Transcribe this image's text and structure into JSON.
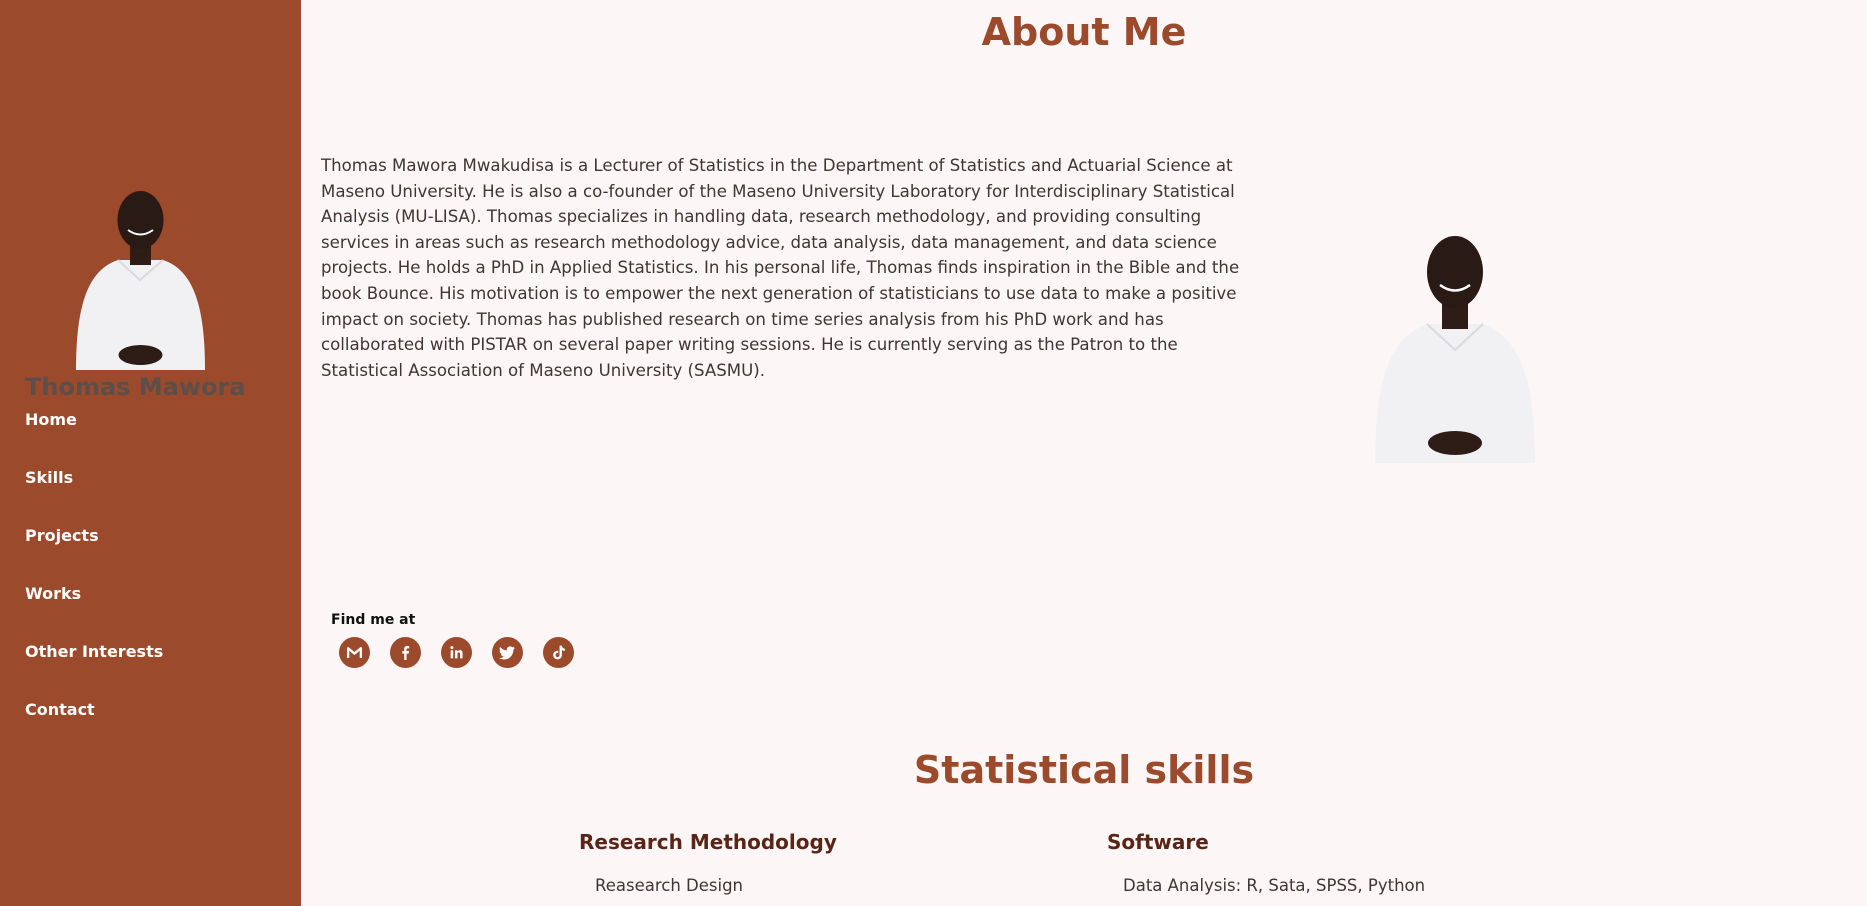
{
  "sidebar": {
    "name": "Thomas Mawora",
    "nav": [
      "Home",
      "Skills",
      "Projects",
      "Works",
      "Other Interests",
      "Contact"
    ]
  },
  "about": {
    "title": "About Me",
    "text": "Thomas Mawora Mwakudisa is a Lecturer of Statistics in the Department of Statistics and Actuarial Science at Maseno University. He is also a co-founder of the Maseno University Laboratory for Interdisciplinary Statistical Analysis (MU-LISA). Thomas specializes in handling data, research methodology, and providing consulting services in areas such as research methodology advice, data analysis, data management, and data science projects. He holds a PhD in Applied Statistics. In his personal life, Thomas finds inspiration in the Bible and the book Bounce. His motivation is to empower the next generation of statisticians to use data to make a positive impact on society. Thomas has published research on time series analysis from his PhD work and has collaborated with PISTAR on several paper writing sessions. He is currently serving as the Patron to the Statistical Association of Maseno University (SASMU)."
  },
  "social": {
    "label": "Find me at",
    "icons": [
      "gmail-icon",
      "facebook-icon",
      "linkedin-icon",
      "twitter-icon",
      "tiktok-icon"
    ]
  },
  "skills": {
    "title": "Statistical skills",
    "col1_heading": "Research Methodology",
    "col1_item": "Reasearch Design",
    "col2_heading": "Software",
    "col2_item": "Data Analysis: R, Sata, SPSS, Python"
  },
  "colors": {
    "accent": "#9c4a2c",
    "background": "#fcf7f6",
    "heading_dark": "#5a2416"
  }
}
